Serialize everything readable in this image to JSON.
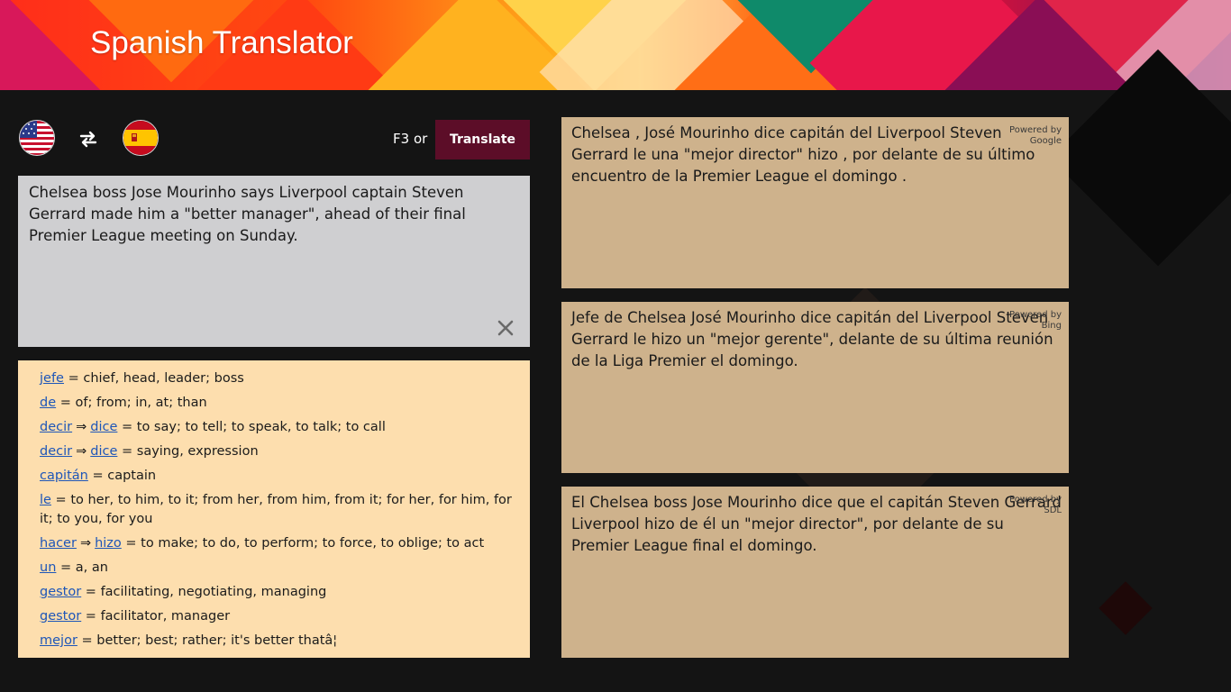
{
  "app": {
    "title": "Spanish Translator"
  },
  "languages": {
    "source_flag": "us-flag-icon",
    "target_flag": "spain-flag-icon",
    "swap_icon": "swap-arrows-icon"
  },
  "toolbar": {
    "shortcut_label": "F3 or",
    "translate_label": "Translate"
  },
  "source": {
    "text": "Chelsea boss Jose Mourinho says Liverpool captain Steven Gerrard made him a \"better manager\", ahead of their final Premier League meeting on Sunday.",
    "clear_icon": "close-icon"
  },
  "dictionary": [
    {
      "word": "jefe",
      "definition": " = chief, head, leader; boss"
    },
    {
      "word": "de",
      "definition": " = of; from; in, at; than"
    },
    {
      "word": "decir",
      "arrow": "⇒",
      "form": "dice",
      "definition": " = to say; to tell; to speak, to talk; to call"
    },
    {
      "word": "decir",
      "arrow": "⇒",
      "form": "dice",
      "definition": " = saying, expression"
    },
    {
      "word": "capitán",
      "definition": " = captain"
    },
    {
      "word": "le",
      "definition": " = to her, to him, to it; from her, from him, from it; for her, for him, for it; to you, for you"
    },
    {
      "word": "hacer",
      "arrow": "⇒",
      "form": "hizo",
      "definition": " = to make; to do, to perform; to force, to oblige; to act"
    },
    {
      "word": "un",
      "definition": " = a, an"
    },
    {
      "word": "gestor",
      "definition": " = facilitating, negotiating, managing"
    },
    {
      "word": "gestor",
      "definition": " = facilitator, manager"
    },
    {
      "word": "mejor",
      "definition": " = better; best; rather; it's better thatâ¦"
    }
  ],
  "translations": [
    {
      "powered_line1": "Powered by",
      "powered_line2": "Google",
      "text": "Chelsea , José Mourinho dice capitán del Liverpool Steven Gerrard le una \"mejor director\" hizo , por delante de su último encuentro de la Premier League el domingo ."
    },
    {
      "powered_line1": "Powered by",
      "powered_line2": "Bing",
      "text": "Jefe de Chelsea José Mourinho dice capitán del Liverpool Steven Gerrard le hizo un \"mejor gerente\", delante de su última reunión de la Liga Premier el domingo."
    },
    {
      "powered_line1": "Powered by",
      "powered_line2": "SDL",
      "text": "El Chelsea boss Jose Mourinho dice que el capitán Steven Gerrard Liverpool hizo de él un \"mejor director\", por delante de su Premier League final el domingo."
    }
  ],
  "colors": {
    "translate_button": "#5c0d28",
    "source_box": "#cfcfd1",
    "dictionary_panel": "#fddeae",
    "translation_card": "#ceb28c",
    "link": "#1e56b8"
  }
}
